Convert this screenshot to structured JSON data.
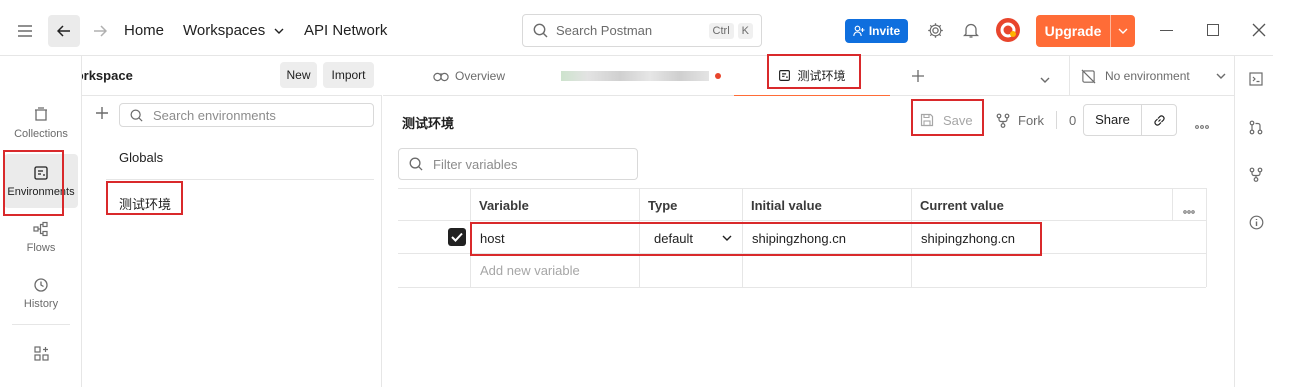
{
  "header": {
    "home": "Home",
    "workspaces": "Workspaces",
    "api_network": "API Network",
    "search_placeholder": "Search Postman",
    "shortcut_ctrl": "Ctrl",
    "shortcut_k": "K",
    "invite": "Invite",
    "upgrade": "Upgrade"
  },
  "workspace": {
    "name": "My Workspace",
    "new_label": "New",
    "import_label": "Import"
  },
  "rail": {
    "items": [
      {
        "label": "Collections",
        "icon": "collections-icon"
      },
      {
        "label": "Environments",
        "icon": "environments-icon"
      },
      {
        "label": "Flows",
        "icon": "flows-icon"
      },
      {
        "label": "History",
        "icon": "history-icon"
      }
    ]
  },
  "sidebar": {
    "search_placeholder": "Search environments",
    "items": [
      "Globals",
      "测试环境"
    ]
  },
  "tabs": {
    "overview": "Overview",
    "active": "测试环境",
    "no_environment": "No environment"
  },
  "env": {
    "title": "测试环境",
    "save": "Save",
    "fork": "Fork",
    "fork_count": "0",
    "share": "Share",
    "filter_placeholder": "Filter variables",
    "columns": [
      "Variable",
      "Type",
      "Initial value",
      "Current value"
    ],
    "rows": [
      {
        "checked": true,
        "variable": "host",
        "type": "default",
        "initial": "shipingzhong.cn",
        "current": "shipingzhong.cn"
      }
    ],
    "add_placeholder": "Add new variable"
  },
  "colors": {
    "accent": "#ff6c37",
    "invite_blue": "#0f6fde",
    "highlight_red": "#d9292b"
  }
}
